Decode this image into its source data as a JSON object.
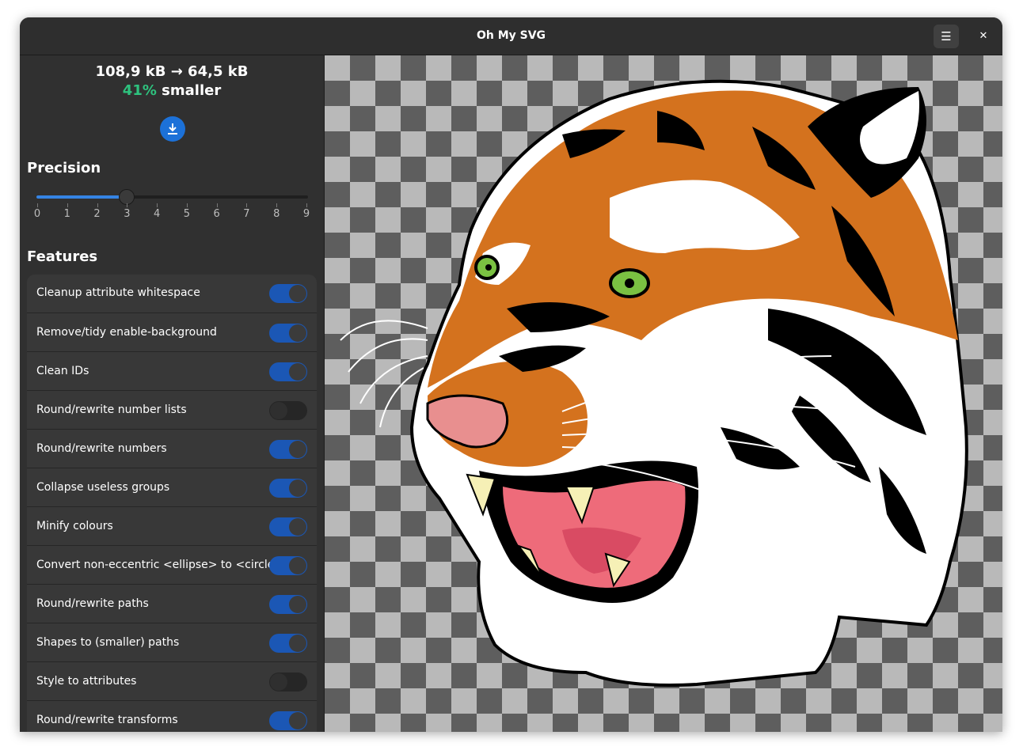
{
  "window": {
    "title": "Oh My SVG"
  },
  "stats": {
    "sizes": "108,9 kB → 64,5 kB",
    "percent": "41%",
    "suffix": " smaller"
  },
  "precision": {
    "heading": "Precision",
    "value": 3,
    "ticks": [
      "0",
      "1",
      "2",
      "3",
      "4",
      "5",
      "6",
      "7",
      "8",
      "9"
    ]
  },
  "features": {
    "heading": "Features",
    "items": [
      {
        "label": "Cleanup attribute whitespace",
        "on": true
      },
      {
        "label": "Remove/tidy enable-background",
        "on": true
      },
      {
        "label": "Clean IDs",
        "on": true
      },
      {
        "label": "Round/rewrite number lists",
        "on": false
      },
      {
        "label": "Round/rewrite numbers",
        "on": true
      },
      {
        "label": "Collapse useless groups",
        "on": true
      },
      {
        "label": "Minify colours",
        "on": true
      },
      {
        "label": "Convert non-eccentric <ellipse> to <circle>",
        "on": true
      },
      {
        "label": "Round/rewrite paths",
        "on": true
      },
      {
        "label": "Shapes to (smaller) paths",
        "on": true
      },
      {
        "label": "Style to attributes",
        "on": false
      },
      {
        "label": "Round/rewrite transforms",
        "on": true
      }
    ]
  },
  "icons": {
    "menu": "hamburger-menu-icon",
    "close": "close-icon",
    "save": "download-icon"
  },
  "colors": {
    "accent": "#1c71d8",
    "success": "#2ec27e",
    "switch_on": "#1b57b5"
  }
}
